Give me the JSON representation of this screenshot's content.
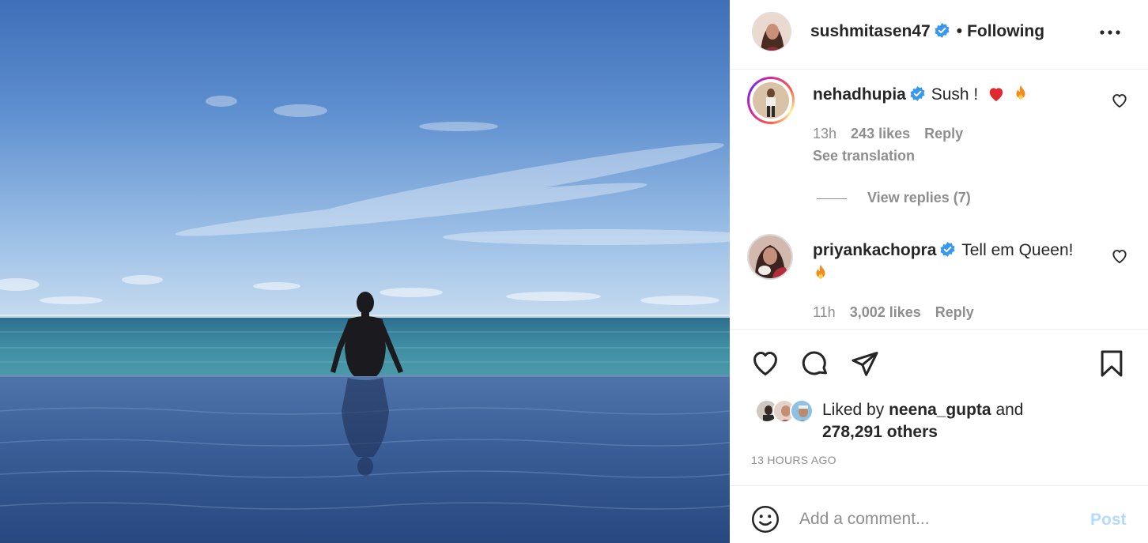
{
  "post": {
    "author": "sushmitasen47",
    "separator": "•",
    "follow_status": "Following",
    "more_icon": "more-horizontal-icon",
    "verified_color": "#3897f0"
  },
  "comments": [
    {
      "username": "nehadhupia",
      "text": "Sush !",
      "emojis": [
        "red-heart-emoji",
        "fire-emoji"
      ],
      "time": "13h",
      "likes": "243 likes",
      "reply": "Reply",
      "see_translation": "See translation",
      "view_replies": "View replies (7)"
    },
    {
      "username": "priyankachopra",
      "text": "Tell em Queen!",
      "emojis": [
        "fire-emoji"
      ],
      "time": "11h",
      "likes": "3,002 likes",
      "reply": "Reply"
    }
  ],
  "actions": {
    "icons": [
      "heart-icon",
      "comment-icon",
      "share-icon",
      "bookmark-icon"
    ]
  },
  "likes": {
    "prefix": "Liked by",
    "user": "neena_gupta",
    "conjunction": "and",
    "others": "278,291 others"
  },
  "timestamp": "13 HOURS AGO",
  "comment_box": {
    "placeholder": "Add a comment...",
    "post_label": "Post",
    "post_color": "#b3dbff"
  }
}
